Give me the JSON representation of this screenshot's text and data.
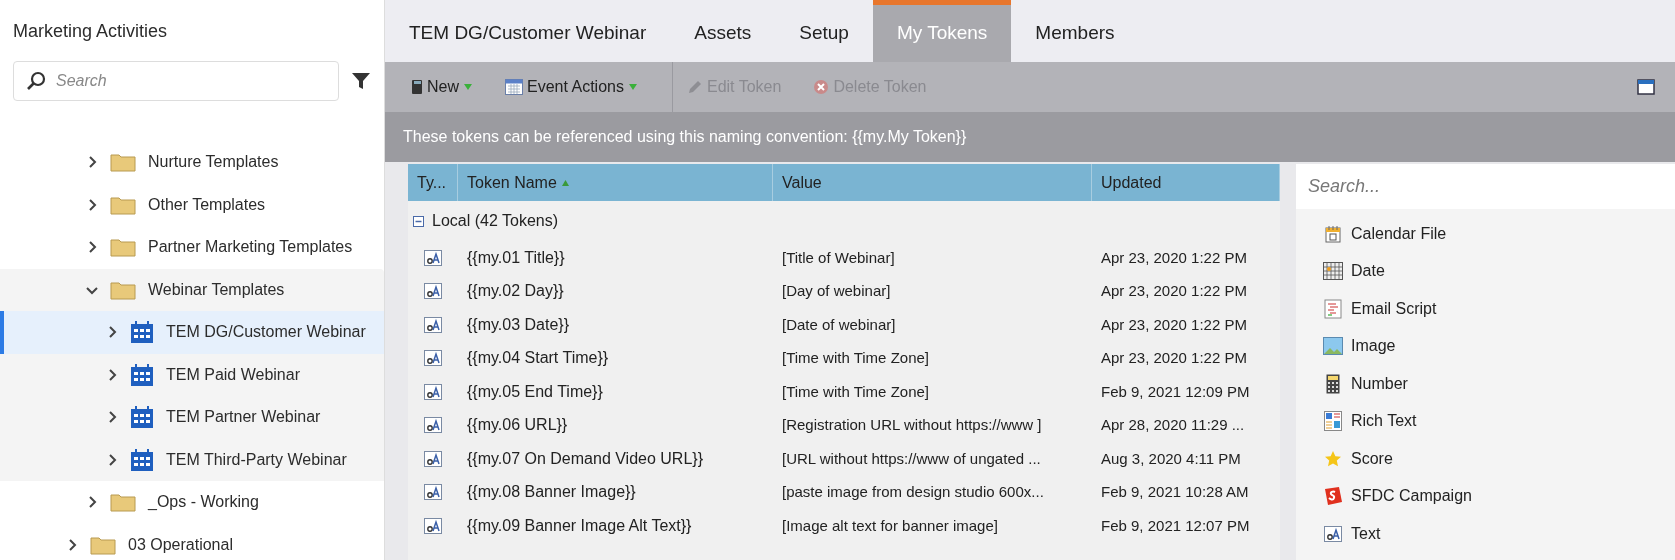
{
  "sidebar": {
    "title": "Marketing Activities",
    "search": {
      "placeholder": "Search"
    },
    "tree": [
      {
        "children": [
          {
            "label": "Nurture Templates",
            "kind": "folder",
            "expanded": false,
            "selected": false
          },
          {
            "label": "Other Templates",
            "kind": "folder",
            "expanded": false,
            "selected": false
          },
          {
            "label": "Partner Marketing Templates",
            "kind": "folder",
            "expanded": false,
            "selected": false
          },
          {
            "label": "Webinar Templates",
            "kind": "folder",
            "expanded": true,
            "selected": false,
            "children": [
              {
                "label": "TEM DG/Customer Webinar",
                "kind": "event",
                "expanded": false,
                "selected": true
              },
              {
                "label": "TEM Paid Webinar",
                "kind": "event",
                "expanded": false,
                "selected": false
              },
              {
                "label": "TEM Partner Webinar",
                "kind": "event",
                "expanded": false,
                "selected": false
              },
              {
                "label": "TEM Third-Party Webinar",
                "kind": "event",
                "expanded": false,
                "selected": false
              }
            ]
          },
          {
            "label": "_Ops - Working",
            "kind": "folder",
            "expanded": false,
            "selected": false
          }
        ]
      },
      {
        "label": "03 Operational",
        "kind": "folder",
        "expanded": false,
        "selected": false
      }
    ]
  },
  "tabs": [
    {
      "label": "TEM DG/Customer Webinar",
      "selected": false
    },
    {
      "label": "Assets",
      "selected": false
    },
    {
      "label": "Setup",
      "selected": false
    },
    {
      "label": "My Tokens",
      "selected": true
    },
    {
      "label": "Members",
      "selected": false
    }
  ],
  "toolbar": [
    {
      "label": "New",
      "kind": "book",
      "dropdown": true,
      "disabled": false
    },
    {
      "label": "Event Actions",
      "kind": "calendar",
      "dropdown": true,
      "disabled": false
    },
    {
      "label": "Edit Token",
      "kind": "pencil",
      "dropdown": false,
      "disabled": true
    },
    {
      "label": "Delete Token",
      "kind": "delete",
      "dropdown": false,
      "disabled": true
    }
  ],
  "info": "These tokens can be referenced using this naming convention: {{my.My Token}}",
  "table": {
    "columns": [
      "Ty...",
      "Token Name",
      "Value",
      "Updated"
    ],
    "group": "Local (42 Tokens)",
    "rows": [
      {
        "kind": "text",
        "name": "{{my.01 Title}}",
        "value": "[Title of Webinar]",
        "updated": "Apr 23, 2020 1:22 PM"
      },
      {
        "kind": "text",
        "name": "{{my.02 Day}}",
        "value": "[Day of webinar]",
        "updated": "Apr 23, 2020 1:22 PM"
      },
      {
        "kind": "text",
        "name": "{{my.03 Date}}",
        "value": "[Date of webinar]",
        "updated": "Apr 23, 2020 1:22 PM"
      },
      {
        "kind": "text",
        "name": "{{my.04 Start Time}}",
        "value": "[Time with Time Zone]",
        "updated": "Apr 23, 2020 1:22 PM"
      },
      {
        "kind": "text",
        "name": "{{my.05 End Time}}",
        "value": "[Time with Time Zone]",
        "updated": "Feb 9, 2021 12:09 PM"
      },
      {
        "kind": "text",
        "name": "{{my.06 URL}}",
        "value": "[Registration URL without https://www ]",
        "updated": "Apr 28, 2020 11:29 ..."
      },
      {
        "kind": "text",
        "name": "{{my.07 On Demand Video URL}}",
        "value": "[URL without https://www of ungated ...",
        "updated": "Aug 3, 2020 4:11 PM"
      },
      {
        "kind": "text",
        "name": "{{my.08 Banner Image}}",
        "value": "[paste image from design studio 600x...",
        "updated": "Feb 9, 2021 10:28 AM"
      },
      {
        "kind": "text",
        "name": "{{my.09 Banner Image Alt Text}}",
        "value": "[Image alt text for banner image]",
        "updated": "Feb 9, 2021 12:07 PM"
      }
    ]
  },
  "token_types": {
    "search": {
      "placeholder": "Search..."
    },
    "items": [
      {
        "label": "Calendar File",
        "kind": "calendar-file"
      },
      {
        "label": "Date",
        "kind": "date"
      },
      {
        "label": "Email Script",
        "kind": "script"
      },
      {
        "label": "Image",
        "kind": "image"
      },
      {
        "label": "Number",
        "kind": "number"
      },
      {
        "label": "Rich Text",
        "kind": "rich"
      },
      {
        "label": "Score",
        "kind": "score"
      },
      {
        "label": "SFDC Campaign",
        "kind": "sfdc"
      },
      {
        "label": "Text",
        "kind": "text"
      }
    ]
  }
}
